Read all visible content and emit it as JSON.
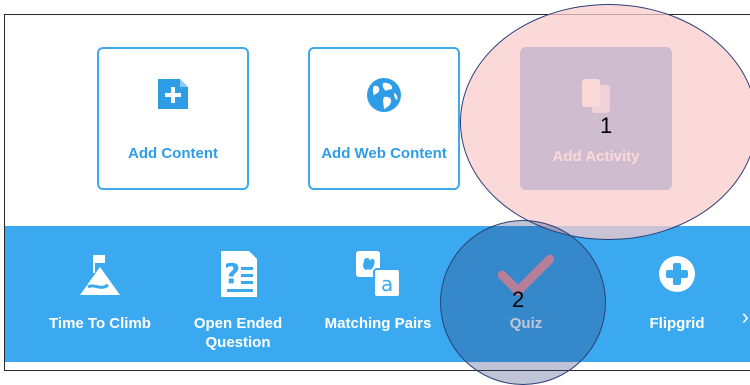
{
  "tiles": [
    {
      "label": "Add Content",
      "icon": "add-content-icon"
    },
    {
      "label": "Add Web Content",
      "icon": "globe-icon"
    },
    {
      "label": "Add Activity",
      "icon": "add-activity-icon"
    }
  ],
  "tools": [
    {
      "label": "Time To Climb",
      "icon": "mountain-flag-icon"
    },
    {
      "label": "Open Ended Question",
      "icon": "question-document-icon"
    },
    {
      "label": "Matching Pairs",
      "icon": "matching-pairs-icon"
    },
    {
      "label": "Quiz",
      "icon": "checkmark-icon"
    },
    {
      "label": "Flipgrid",
      "icon": "plus-circle-icon"
    }
  ],
  "scroll": {
    "icon": "chevron-right-icon",
    "glyph": "›"
  },
  "annotations": [
    {
      "number": "1",
      "fill": "#f9cccc"
    },
    {
      "number": "2",
      "fill": "#2c3f78"
    }
  ],
  "colors": {
    "accent": "#3aa9f0",
    "tile_border": "#41a8ec",
    "active_tile": "#4f8fd6",
    "quiz_check": "#f39aa8"
  }
}
